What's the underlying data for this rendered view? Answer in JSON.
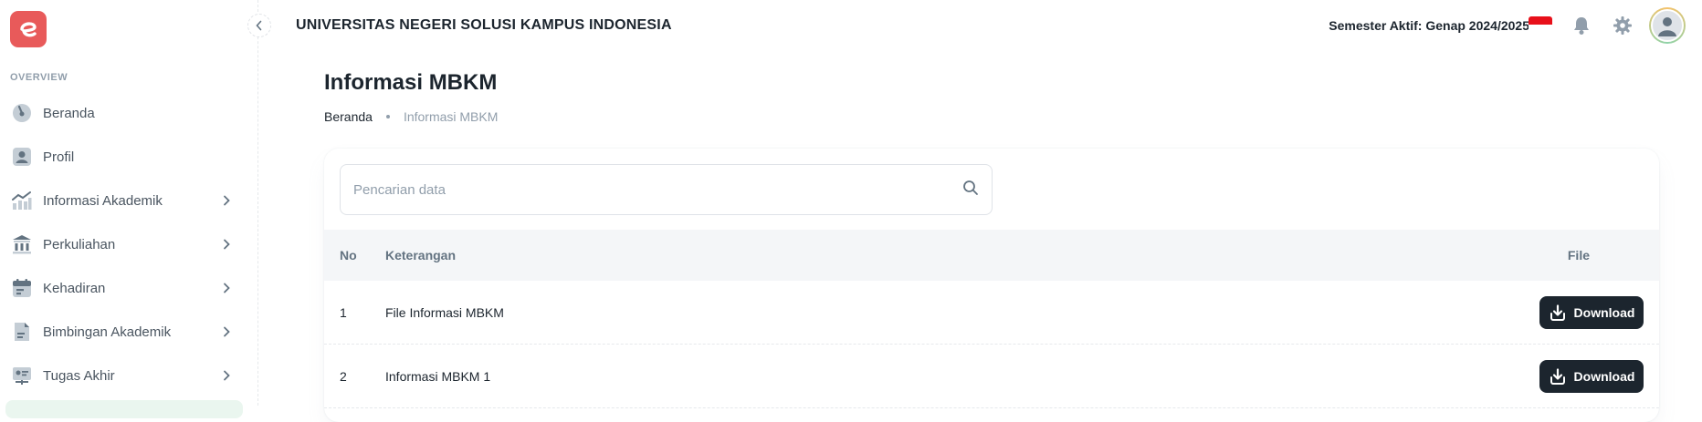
{
  "sidebar": {
    "subheader": "OVERVIEW",
    "items": [
      {
        "label": "Beranda",
        "icon": "dashboard-icon"
      },
      {
        "label": "Profil",
        "icon": "user-profile-icon"
      },
      {
        "label": "Informasi Akademik",
        "icon": "analytics-icon"
      },
      {
        "label": "Perkuliahan",
        "icon": "institution-icon"
      },
      {
        "label": "Kehadiran",
        "icon": "calendar-icon"
      },
      {
        "label": "Bimbingan Akademik",
        "icon": "document-icon"
      },
      {
        "label": "Tugas Akhir",
        "icon": "presentation-icon"
      }
    ]
  },
  "topbar": {
    "title": "UNIVERSITAS NEGERI SOLUSI KAMPUS INDONESIA",
    "semester": "Semester Aktif: Genap 2024/2025"
  },
  "page": {
    "title": "Informasi MBKM",
    "breadcrumb": [
      "Beranda",
      "Informasi MBKM"
    ]
  },
  "search": {
    "placeholder": "Pencarian data",
    "value": ""
  },
  "table": {
    "headers": [
      "No",
      "Keterangan",
      "File"
    ],
    "rows": [
      {
        "no": "1",
        "keterangan": "File Informasi MBKM",
        "action": "Download"
      },
      {
        "no": "2",
        "keterangan": "Informasi MBKM 1",
        "action": "Download"
      }
    ]
  },
  "colors": {
    "logo": "#e85a5a",
    "primary_button": "#1c252e",
    "flag_red": "#e8101a"
  }
}
